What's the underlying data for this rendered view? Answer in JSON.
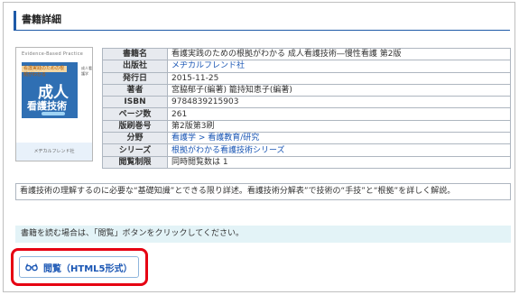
{
  "section": {
    "title": "書籍詳細"
  },
  "cover": {
    "top_text": "Evidence-Based Practice",
    "tag": "看護実践のための根拠がわかる",
    "side_text": "成人看護学",
    "title_line1": "成人",
    "title_line2": "看護技術",
    "bottom_text": "メヂカルフレンド社"
  },
  "info_rows": [
    {
      "label": "書籍名",
      "value": "看護実践のための根拠がわかる 成人看護技術―慢性看護 第2版"
    },
    {
      "label": "出版社",
      "value": "メヂカルフレンド社"
    },
    {
      "label": "発行日",
      "value": "2015-11-25"
    },
    {
      "label": "著者",
      "value": "宮脇郁子(編著) 籠持知恵子(編著)"
    },
    {
      "label": "ISBN",
      "value": "9784839215903"
    },
    {
      "label": "ページ数",
      "value": "261"
    },
    {
      "label": "版刷巻号",
      "value": "第2版第3刷"
    },
    {
      "label": "分野",
      "value": "看護学 > 看護教育/研究"
    },
    {
      "label": "シリーズ",
      "value": "根拠がわかる看護技術シリーズ"
    },
    {
      "label": "閲覧制限",
      "value": "同時閲覧数は 1"
    }
  ],
  "description": "看護技術の理解するのに必要な“基礎知識”とできる限り詳述。看護技術分解表”で技術の“手技”と“根拠”を詳しく解説。",
  "notice": "書籍を読む場合は、「閲覧」ボタンをクリックしてください。",
  "read_button": {
    "label": "閲覧（HTML5形式）"
  },
  "colors": {
    "accent": "#1e5aa8",
    "highlight": "#e60012",
    "notice_bg": "#e3f3f7"
  }
}
